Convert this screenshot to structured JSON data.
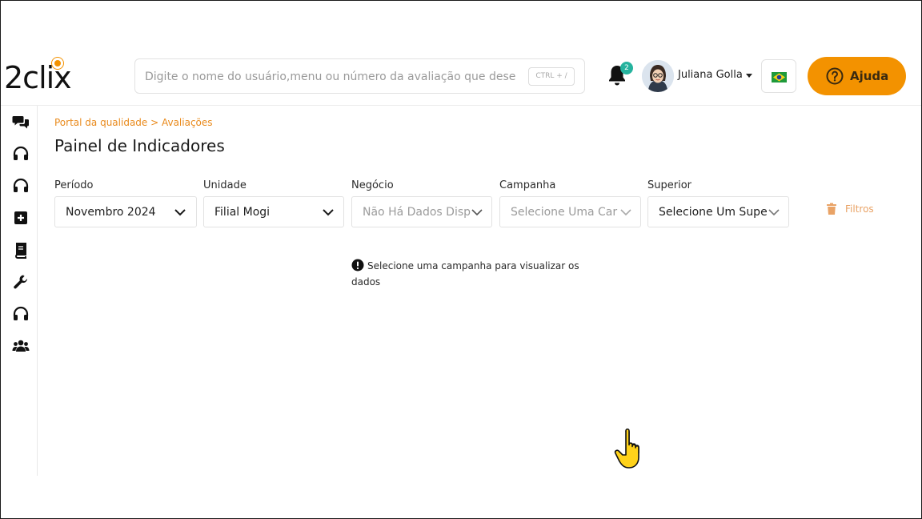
{
  "app": {
    "logo_text": "2clix",
    "brand_color": "#f39200"
  },
  "header": {
    "search": {
      "placeholder": "Digite o nome do usuário,menu ou número da avaliação que dese",
      "shortcut": "CTRL + /"
    },
    "notifications": {
      "count": "2",
      "icon": "bell-icon"
    },
    "user": {
      "name": "Juliana Golla"
    },
    "language_flag": "brazil-flag-icon",
    "help_button": {
      "label": "Ajuda",
      "icon": "question-circle-icon"
    }
  },
  "sidebar": {
    "items": [
      {
        "icon": "chat-bubbles-icon"
      },
      {
        "icon": "headset-icon"
      },
      {
        "icon": "headset-icon"
      },
      {
        "icon": "plus-square-icon"
      },
      {
        "icon": "book-icon"
      },
      {
        "icon": "wrench-icon"
      },
      {
        "icon": "headset-icon"
      },
      {
        "icon": "users-icon"
      }
    ]
  },
  "main": {
    "breadcrumb": "Portal da qualidade > Avaliações",
    "title": "Painel de Indicadores",
    "filters": [
      {
        "label": "Período",
        "value": "Novembro 2024"
      },
      {
        "label": "Unidade",
        "value": "Filial Mogi"
      },
      {
        "label": "Negócio",
        "value": "Não Há Dados Disp"
      },
      {
        "label": "Campanha",
        "value": "Selecione Uma Car"
      },
      {
        "label": "Superior",
        "value": "Selecione Um Supe"
      }
    ],
    "filters_button": "Filtros",
    "notice_text": "Selecione uma campanha para visualizar os dados"
  }
}
